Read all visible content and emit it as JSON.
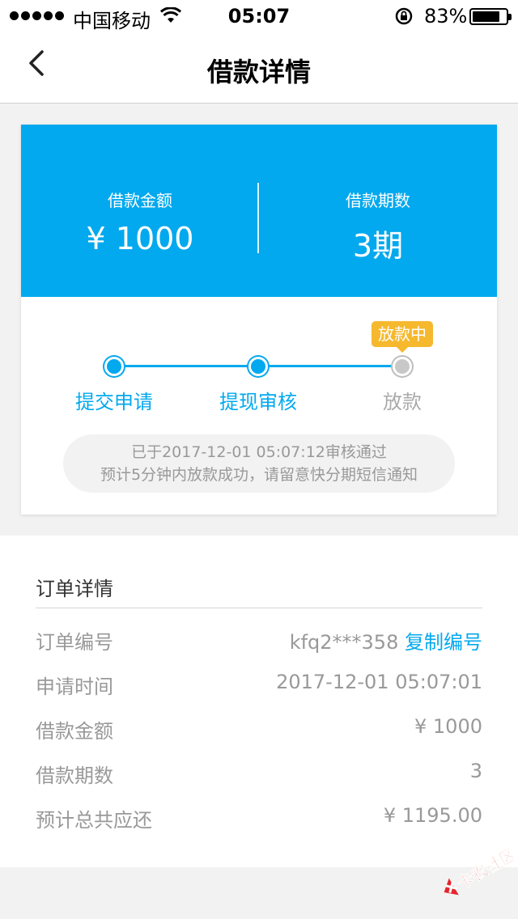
{
  "status_bar": {
    "carrier": "中国移动",
    "time": "05:07",
    "battery_percent": "83%",
    "battery_level": 0.83
  },
  "nav": {
    "title": "借款详情",
    "back_icon": "chevron-left-icon"
  },
  "loan_summary": {
    "amount_label": "借款金额",
    "amount_value": "¥ 1000",
    "periods_label": "借款期数",
    "periods_value": "3期",
    "color": "#03a9ee"
  },
  "progress": {
    "steps": [
      {
        "label": "提交申请",
        "state": "done"
      },
      {
        "label": "提现审核",
        "state": "done"
      },
      {
        "label": "放款",
        "state": "pending"
      }
    ],
    "badge": "放款中",
    "badge_color": "#f6b82c",
    "note_line1": "已于2017-12-01 05:07:12审核通过",
    "note_line2": "预计5分钟内放款成功，请留意快分期短信通知"
  },
  "order": {
    "header": "订单详情",
    "rows": [
      {
        "label": "订单编号",
        "value": "kfq2***358",
        "action": "复制编号"
      },
      {
        "label": "申请时间",
        "value": "2017-12-01 05:07:01"
      },
      {
        "label": "借款金额",
        "value": "¥ 1000"
      },
      {
        "label": "借款期数",
        "value": "3"
      },
      {
        "label": "预计总共应还",
        "value": "¥ 1195.00"
      }
    ]
  },
  "watermark": {
    "text": "卡农社区"
  }
}
